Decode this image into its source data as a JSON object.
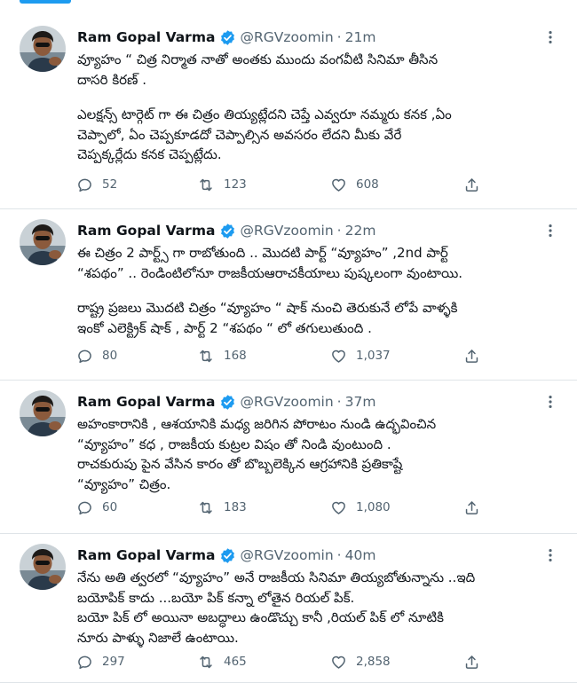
{
  "user": {
    "name": "Ram Gopal Varma",
    "handle": "@RGVzoomin"
  },
  "colors": {
    "verified": "#1d9bf0",
    "text": "#0f1419",
    "secondary": "#536471",
    "divider": "#dfe4e8"
  },
  "icons": {
    "reply": "reply-icon",
    "retweet": "retweet-icon",
    "like": "heart-icon",
    "share": "share-icon",
    "more": "more-icon",
    "verified": "verified-badge-icon"
  },
  "tweets": [
    {
      "time": "21m",
      "lines": [
        "వ్యూహం “ చిత్ర నిర్మాత నాతో అంతకు ముందు వంగవీటి సినిమా తీసిన",
        "దాసరి కిరణ్ .",
        "",
        "ఎలక్షన్స్ టార్గెట్ గా ఈ చిత్రం తియ్యట్లేదని చెప్తే ఎవ్వరూ నమ్మరు కనక ,ఏం",
        "చెప్పాలో, ఏం చెప్పకూడదో చెప్పాల్సిన అవసరం లేదని మీకు వేరే",
        "చెప్పక్కర్లేదు కనక చెప్పట్లేదు."
      ],
      "replies": "52",
      "retweets": "123",
      "likes": "608"
    },
    {
      "time": "22m",
      "lines": [
        "ఈ  చిత్రం 2 పార్ట్స్ గా రాబోతుంది .. మొదటి పార్ట్ “వ్యూహం” ,2nd పార్ట్",
        "“శపథం” .. రెండింటిలోనూ రాజకీయఆరాచకీయాలు  పుష్కలంగా వుంటాయి.",
        "",
        "రాష్ట్ర ప్రజలు మొదటి చిత్రం “వ్యూహం “ షాక్ నుంచి తెరుకునే లోపే  వాళ్ళకి",
        "ఇంకో ఎలెక్ట్రిక్ షాక్ , పార్ట్ 2 “శపథం “ లో తగులుతుంది ."
      ],
      "replies": "80",
      "retweets": "168",
      "likes": "1,037"
    },
    {
      "time": "37m",
      "lines": [
        "అహంకారానికి , ఆశయానికి మధ్య జరిగిన పోరాటం నుండి ఉద్భవించిన",
        "“వ్యూహం” కధ , రాజకీయ కుట్రల విషం తో నిండి వుంటుంది .",
        "రాచకురుపు పైన వేసిన కారం తో బొబ్బలెక్కిన ఆగ్రహానికి ప్రతికాష్టే",
        "“వ్యూహం” చిత్రం."
      ],
      "replies": "60",
      "retweets": "183",
      "likes": "1,080"
    },
    {
      "time": "40m",
      "lines": [
        "నేను అతి త్వరలో  “వ్యూహం”  అనే రాజకీయ సినిమా తియ్యబోతున్నాను ..ఇది",
        "బయోపిక్ కాదు ...బయో పిక్ కన్నా లోతైన రియల్ పిక్.",
        "బయో పిక్ లో అయినా అబద్ధాలు ఉండొచ్చు కానీ ,రియల్ పిక్ లో నూటికి",
        "నూరు పాళ్ళు నిజాలే ఉంటాయి."
      ],
      "replies": "297",
      "retweets": "465",
      "likes": "2,858"
    }
  ]
}
